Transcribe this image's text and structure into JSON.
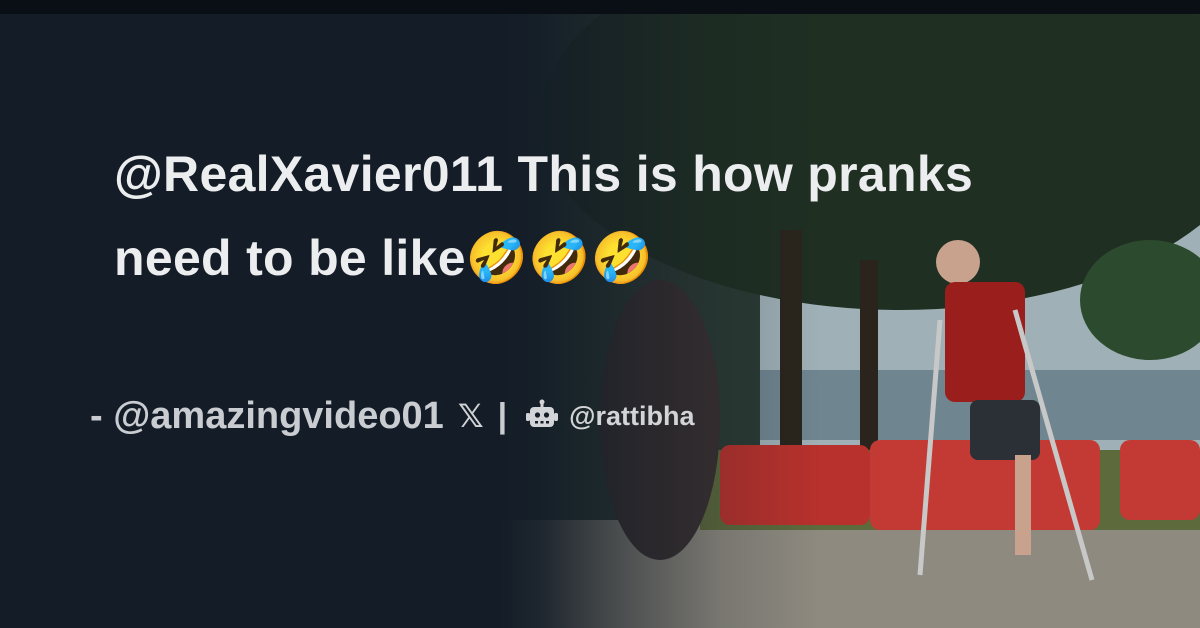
{
  "tweet": {
    "text": "@RealXavier011 This is how pranks need to be like🤣🤣🤣"
  },
  "byline": {
    "author": "- @amazingvideo01",
    "x_icon": "𝕏",
    "separator": "|",
    "robot_icon": "robot-icon",
    "brand": "@rattibha"
  },
  "colors": {
    "background": "#141d27",
    "text": "#ecedee",
    "byline": "#c9ccd0"
  }
}
